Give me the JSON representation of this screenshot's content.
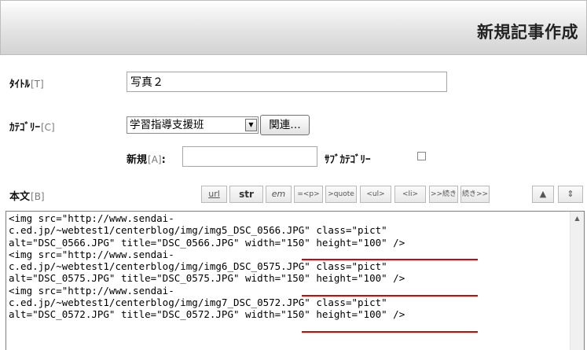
{
  "header": {
    "title": "新規記事作成"
  },
  "form": {
    "title_label": "ﾀｲﾄﾙ",
    "title_key": "[T]",
    "title_value": "写真２",
    "category_label": "ｶﾃｺﾞﾘｰ",
    "category_key": "[C]",
    "category_value": "学習指導支援班",
    "related_button": "関連…",
    "new_label": "新規",
    "new_key": "[A]",
    "new_colon": ":",
    "new_value": "",
    "subcategory_label": "ｻﾌﾞｶﾃｺﾞﾘｰ",
    "body_label": "本文",
    "body_key": "[B]"
  },
  "toolbar": [
    {
      "name": "url-button",
      "label": "url"
    },
    {
      "name": "str-button",
      "label": "str"
    },
    {
      "name": "em-button",
      "label": "em"
    },
    {
      "name": "p-button",
      "label": "=<p>"
    },
    {
      "name": "quote-button",
      "label": ">quote"
    },
    {
      "name": "ul-button",
      "label": "<ul>"
    },
    {
      "name": "li-button",
      "label": "<li>"
    },
    {
      "name": "expand-button",
      "label": ">>続き"
    },
    {
      "name": "continue-button",
      "label": "続き>>"
    },
    {
      "name": "collapse-up-button",
      "label": "▲"
    },
    {
      "name": "resize-button",
      "label": "⇕"
    }
  ],
  "body_text": "<img src=\"http://www.sendai-\nc.ed.jp/~webtest1/centerblog/img/img5_DSC_0566.JPG\" class=\"pict\"\nalt=\"DSC_0566.JPG\" title=\"DSC_0566.JPG\" width=\"150\" height=\"100\" />\n<img src=\"http://www.sendai-\nc.ed.jp/~webtest1/centerblog/img/img6_DSC_0575.JPG\" class=\"pict\"\nalt=\"DSC_0575.JPG\" title=\"DSC_0575.JPG\" width=\"150\" height=\"100\" />\n<img src=\"http://www.sendai-\nc.ed.jp/~webtest1/centerblog/img/img7_DSC_0572.JPG\" class=\"pict\"\nalt=\"DSC_0572.JPG\" title=\"DSC_0572.JPG\" width=\"150\" height=\"100\" />",
  "colors": {
    "annotation_underline": "#e00000",
    "header_gradient_end": "#d3d3d3"
  }
}
